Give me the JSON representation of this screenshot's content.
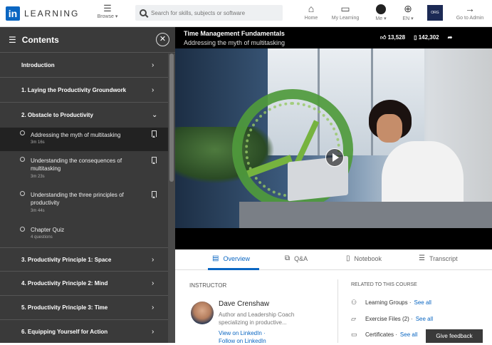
{
  "topbar": {
    "logo_mark": "in",
    "logo_text": "LEARNING",
    "browse_label": "Browse ▾",
    "search_placeholder": "Search for skills, subjects or software",
    "nav": {
      "home": "Home",
      "my_learning": "My Learning",
      "me": "Me ▾",
      "lang": "EN ▾",
      "admin": "Go to Admin"
    }
  },
  "sidebar": {
    "title": "Contents",
    "chapters": [
      {
        "label": "Introduction"
      },
      {
        "label": "1. Laying the Productivity Groundwork"
      },
      {
        "label": "2. Obstacle to Productivity"
      },
      {
        "label": "3. Productivity Principle 1: Space"
      },
      {
        "label": "4. Productivity Principle 2: Mind"
      },
      {
        "label": "5. Productivity Principle 3: Time"
      },
      {
        "label": "6. Equipping Yourself for Action"
      }
    ],
    "items": [
      {
        "title": "Addressing the myth of multitasking",
        "duration": "3m 16s"
      },
      {
        "title": "Understanding the consequences of multitasking",
        "duration": "3m 23s"
      },
      {
        "title": "Understanding the three principles of productivity",
        "duration": "3m 44s"
      },
      {
        "title": "Chapter Quiz",
        "duration": "4 questions"
      }
    ]
  },
  "video": {
    "course_title": "Time Management Fundamentals",
    "video_title": "Addressing the myth of multitasking",
    "likes": "13,528",
    "saves": "142,302"
  },
  "tabs": [
    {
      "label": "Overview"
    },
    {
      "label": "Q&A"
    },
    {
      "label": "Notebook"
    },
    {
      "label": "Transcript"
    }
  ],
  "instructor": {
    "section_label": "INSTRUCTOR",
    "name": "Dave Crenshaw",
    "role": "Author and Leadership Coach specializing in productive...",
    "link1": "View on LinkedIn ·",
    "link2": "Follow on LinkedIn"
  },
  "related": {
    "section_label": "RELATED TO THIS COURSE",
    "items": [
      {
        "label": "Learning Groups ·",
        "link": "See all"
      },
      {
        "label": "Exercise Files (2) ·",
        "link": "See all"
      },
      {
        "label": "Certificates ·",
        "link": "See all"
      }
    ]
  },
  "feedback_label": "Give feedback",
  "colors": {
    "accent": "#0a66c2",
    "sidebar": "#3a3a3a",
    "clock_green": "#4f9a3c"
  }
}
